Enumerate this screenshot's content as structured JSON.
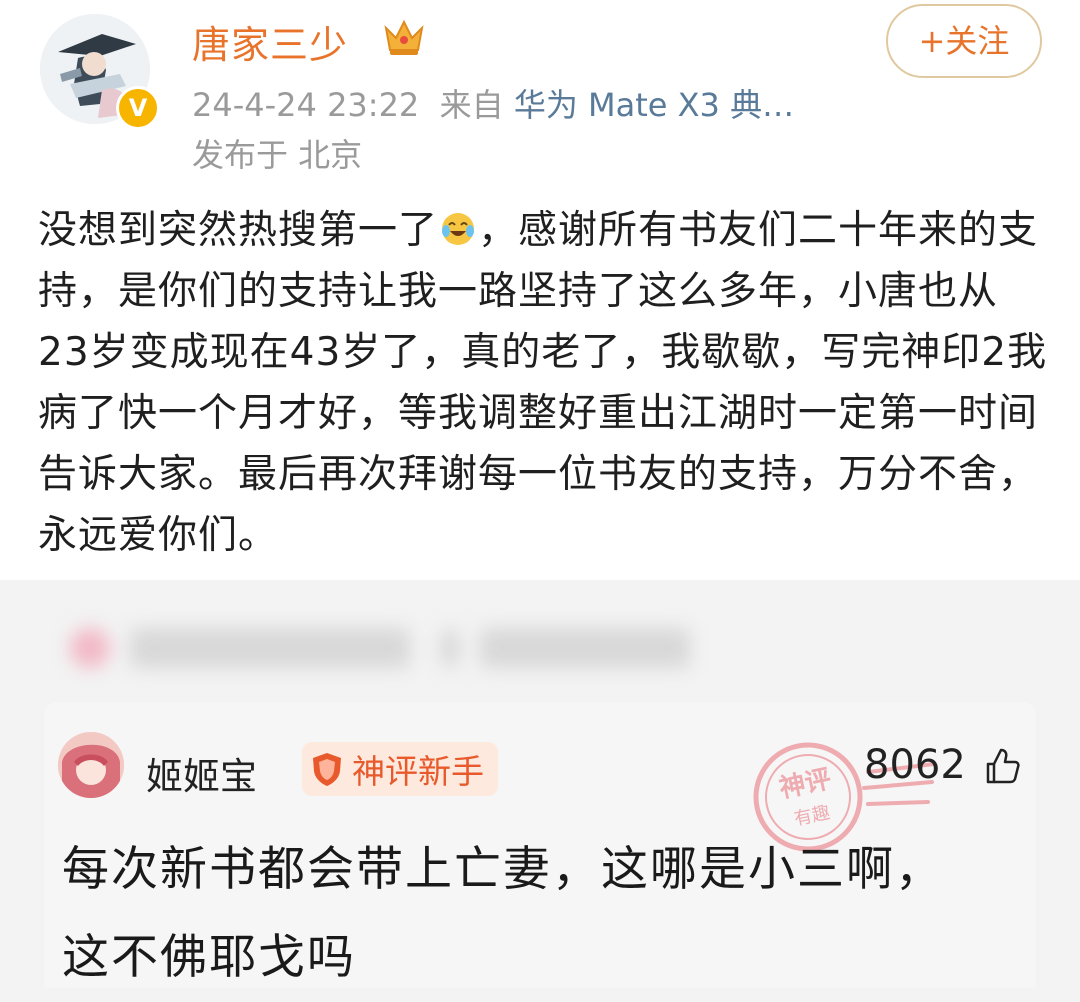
{
  "post": {
    "author": "唐家三少",
    "follow_label": "+关注",
    "time": "24-4-24 23:22",
    "source_prefix": "来自",
    "source_device": "华为 Mate X3 典…",
    "location": "发布于 北京",
    "content_part1": "没想到突然热搜第一了",
    "content_part2": "，感谢所有书友们二十年来的支持，是你们的支持让我一路坚持了这么多年，小唐也从23岁变成现在43岁了，真的老了，我歇歇，写完神印2我病了快一个月才好，等我调整好重出江湖时一定第一时间告诉大家。最后再次拜谢每一位书友的支持，万分不舍，永远爱你们。"
  },
  "comment": {
    "user": "姬姬宝",
    "badge": "神评新手",
    "likes": "8062",
    "text": "每次新书都会带上亡妻，这哪是小三啊，这不佛耶戈吗",
    "stamp_line1": "神评",
    "stamp_line2": "有趣"
  },
  "icons": {
    "verified": "verified-v-icon",
    "crown": "crown-icon",
    "emoji": "laughing-tears-emoji",
    "shield": "shield-badge-icon",
    "like": "thumbs-up-icon"
  },
  "colors": {
    "accent": "#e8742c",
    "verified": "#f7b500",
    "device_link": "#5a7a9a",
    "badge_bg": "#fde9dd",
    "badge_text": "#e85a2c"
  }
}
